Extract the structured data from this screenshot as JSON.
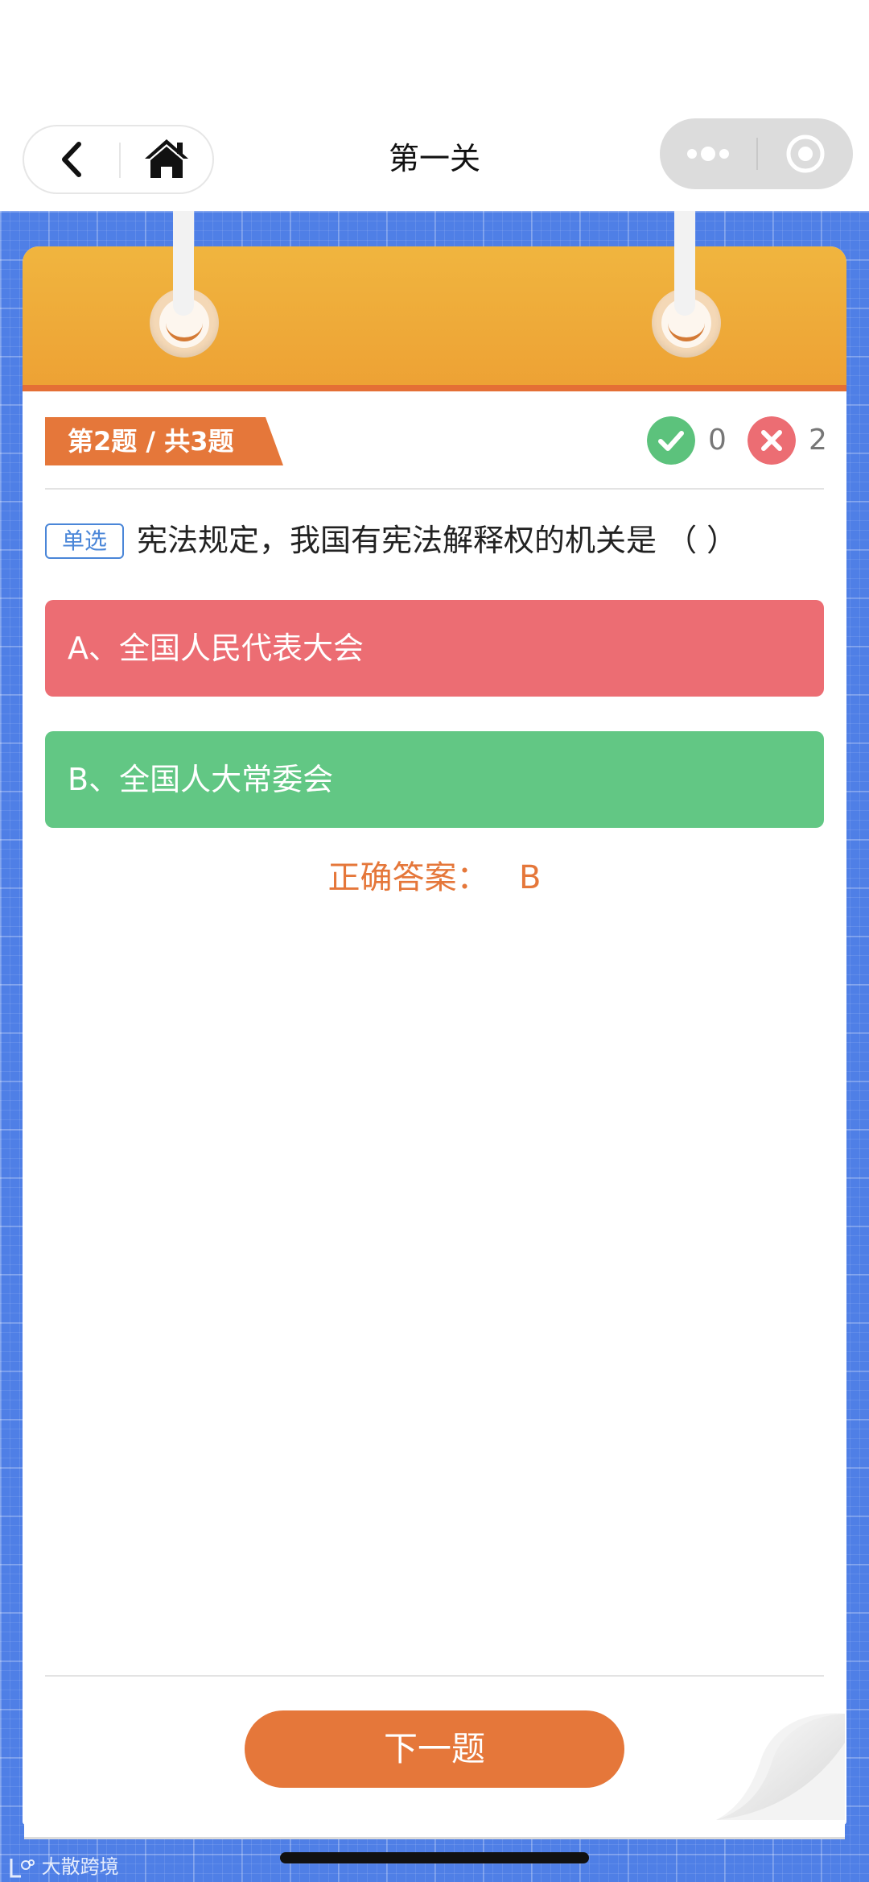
{
  "nav": {
    "title": "第一关"
  },
  "quiz": {
    "progress_label": "第2题 / 共3题",
    "correct_count": "0",
    "wrong_count": "2",
    "question_type": "单选",
    "question_text": "宪法规定，我国有宪法解释权的机关是 （ ）",
    "options": [
      {
        "label": "A、全国人民代表大会",
        "state": "wrong"
      },
      {
        "label": "B、全国人大常委会",
        "state": "correct"
      }
    ],
    "correct_answer_label": "正确答案：",
    "correct_answer_value": "B",
    "next_button_label": "下一题"
  },
  "watermark": {
    "text": "大散跨境"
  },
  "colors": {
    "accent_orange": "#e5773a",
    "header_yellow": "#f0b53f",
    "grid_blue": "#4f7fe6",
    "correct_green": "#62c784",
    "wrong_red": "#ec6d73",
    "type_badge_blue": "#4a86d8"
  },
  "icons": {
    "back": "chevron-left-icon",
    "home": "home-icon",
    "more": "more-dots-icon",
    "close": "target-circle-icon",
    "correct": "check-icon",
    "wrong": "cross-icon"
  }
}
